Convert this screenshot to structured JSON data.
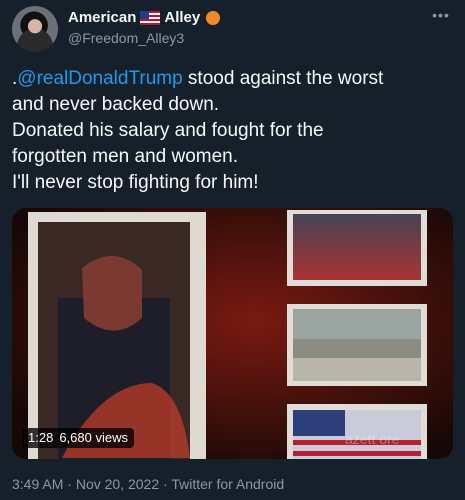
{
  "author": {
    "name": "American",
    "name_suffix": "Alley",
    "handle": "@Freedom_Alley3"
  },
  "tweet": {
    "prefix": ".",
    "mention": "@realDonaldTrump",
    "line1_rest": " stood against the worst",
    "line2": "and never backed down.",
    "line3": "Donated his salary and fought for the",
    "line4": "forgotten men and women.",
    "line5": "I'll never stop fighting for him!"
  },
  "video": {
    "duration": "1:28",
    "views": "6,680 views",
    "watermark": "azett ore"
  },
  "footer": {
    "time": "3:49 AM",
    "sep1": "·",
    "date": "Nov 20, 2022",
    "sep2": "·",
    "client": "Twitter for Android"
  },
  "colors": {
    "background": "#15202b",
    "link": "#1d9bf0",
    "muted": "#8b98a5",
    "badge": "#f08a24"
  }
}
